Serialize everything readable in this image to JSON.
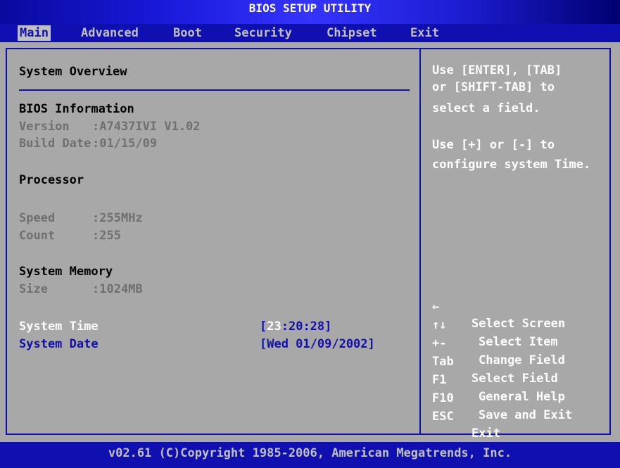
{
  "title": "BIOS SETUP UTILITY",
  "menu": [
    {
      "label": "Main",
      "active": true
    },
    {
      "label": "Advanced"
    },
    {
      "label": "Boot"
    },
    {
      "label": "Security"
    },
    {
      "label": "Chipset"
    },
    {
      "label": "Exit"
    }
  ],
  "overview": {
    "heading": "System Overview",
    "bios_heading": "BIOS Information",
    "version_label": "Version",
    "version_value": ":A7437IVI V1.02",
    "build_label": "Build Date",
    "build_value": ":01/15/09",
    "processor_heading": "Processor",
    "speed_label": "Speed",
    "speed_value": ":255MHz",
    "count_label": "Count",
    "count_value": ":255",
    "memory_heading": "System Memory",
    "size_label": "Size",
    "size_value": ":1024MB",
    "time_label": "System Time",
    "time_open": "[",
    "time_hours": "23",
    "time_rest": ":20:28]",
    "date_label": "System Date",
    "date_value": "[Wed 01/09/2002]"
  },
  "help": {
    "line1": "Use [ENTER], [TAB]",
    "line2": "or [SHIFT-TAB] to",
    "line3": "select a field.",
    "line4": "Use [+] or [-] to",
    "line5": "configure system Time."
  },
  "keys": [
    {
      "key": "←",
      "desc": "Select Screen"
    },
    {
      "key": "↑↓",
      "desc": "Select Item"
    },
    {
      "key": "+-",
      "desc": "Change Field"
    },
    {
      "key": "Tab",
      "desc": "Select Field"
    },
    {
      "key": "F1",
      "desc": "General Help"
    },
    {
      "key": "F10",
      "desc": "Save and Exit"
    },
    {
      "key": "ESC",
      "desc": "Exit"
    }
  ],
  "footer": "v02.61 (C)Copyright 1985-2006, American Megatrends, Inc."
}
